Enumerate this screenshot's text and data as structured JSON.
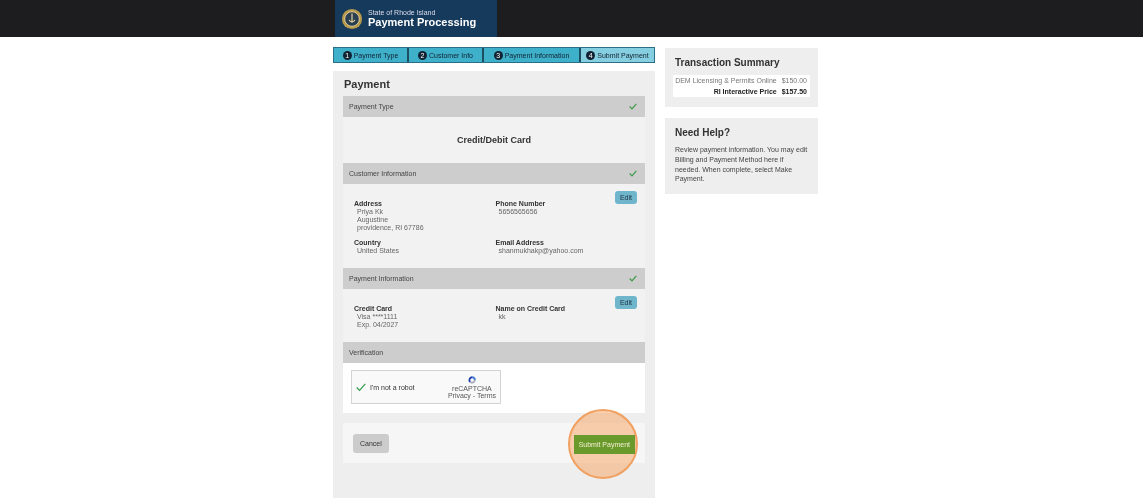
{
  "header": {
    "agency": "State of Rhode Island",
    "title": "Payment Processing"
  },
  "steps": [
    {
      "number": "1",
      "label": "Payment Type",
      "selected": false
    },
    {
      "number": "2",
      "label": "Customer Info",
      "selected": false
    },
    {
      "number": "3",
      "label": "Payment Information",
      "selected": false
    },
    {
      "number": "4",
      "label": "Submit Payment",
      "selected": true
    }
  ],
  "payment": {
    "title": "Payment",
    "sections": [
      {
        "kind": "type",
        "title": "Payment Type",
        "complete": true,
        "value": "Credit/Debit Card"
      },
      {
        "kind": "fields",
        "title": "Customer Information",
        "complete": true,
        "edit": "Edit",
        "fields": [
          {
            "label": "Address",
            "lines": [
              "Priya Kk",
              "Augustine",
              "providence, RI 67786"
            ]
          },
          {
            "label": "Phone Number",
            "lines": [
              "5656565656"
            ]
          },
          {
            "label": "Country",
            "lines": [
              "United States"
            ]
          },
          {
            "label": "Email Address",
            "lines": [
              "shanmukhakp@yahoo.com"
            ]
          }
        ]
      },
      {
        "kind": "fields",
        "title": "Payment Information",
        "complete": true,
        "edit": "Edit",
        "fields": [
          {
            "label": "Credit Card",
            "lines": [
              "Visa ****1111",
              "Exp. 04/2027"
            ]
          },
          {
            "label": "Name on Credit Card",
            "lines": [
              "kk"
            ]
          }
        ]
      },
      {
        "kind": "captcha",
        "title": "Verification",
        "complete": false,
        "captcha": {
          "label": "I'm not a robot",
          "checked": true,
          "brand": "reCAPTCHA",
          "links": "Privacy - Terms"
        }
      }
    ],
    "cancel": "Cancel",
    "submit": "Submit Payment",
    "highlight_submit": true
  },
  "summary": {
    "title": "Transaction Summary",
    "rows": [
      {
        "label": "DEM Licensing & Permits Online",
        "amount": "$150.00",
        "bold": false
      },
      {
        "label": "RI Interactive Price",
        "amount": "$157.50",
        "bold": true
      }
    ]
  },
  "help": {
    "title": "Need Help?",
    "text": "Review payment information. You may edit Billing and Payment Method here if needed. When complete, select Make Payment."
  }
}
